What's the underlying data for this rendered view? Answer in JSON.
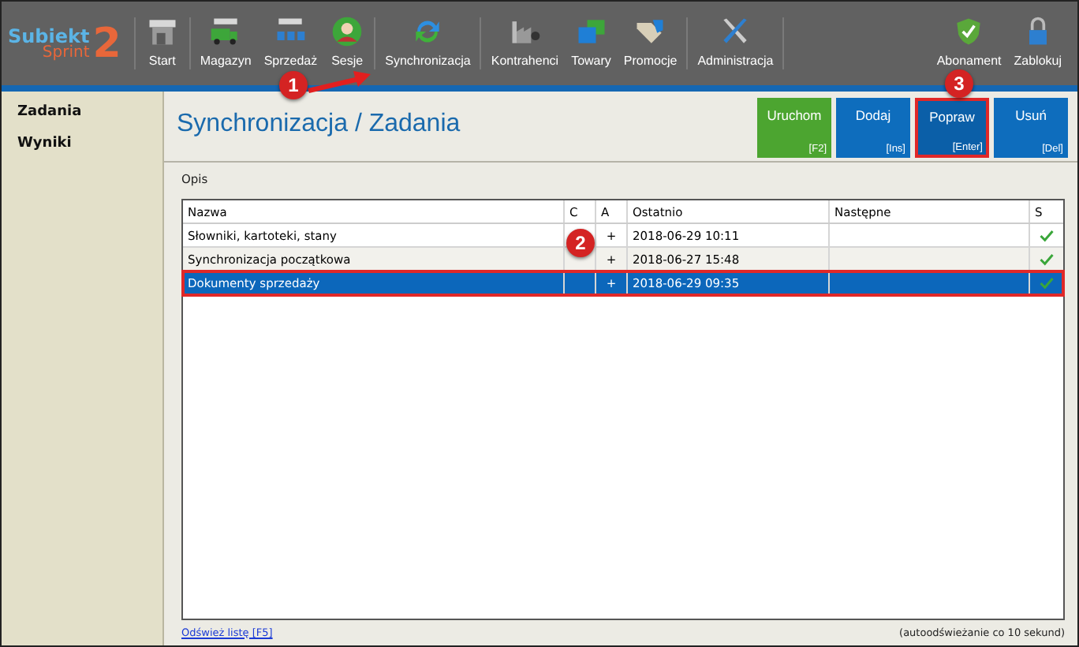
{
  "logo": {
    "name": "Subiekt",
    "sub": "Sprint",
    "num": "2"
  },
  "toolbar": {
    "left": [
      [
        {
          "label": "Start"
        }
      ],
      [
        {
          "label": "Magazyn"
        },
        {
          "label": "Sprzedaż"
        },
        {
          "label": "Sesje"
        }
      ],
      [
        {
          "label": "Synchronizacja"
        }
      ],
      [
        {
          "label": "Kontrahenci"
        },
        {
          "label": "Towary"
        },
        {
          "label": "Promocje"
        }
      ],
      [
        {
          "label": "Administracja"
        }
      ]
    ],
    "right": [
      {
        "label": "Abonament"
      },
      {
        "label": "Zablokuj"
      }
    ]
  },
  "sidebar": {
    "items": [
      {
        "label": "Zadania"
      },
      {
        "label": "Wyniki"
      }
    ]
  },
  "page_title": "Synchronizacja / Zadania",
  "actions": [
    {
      "label": "Uruchom",
      "key": "[F2]",
      "kind": "run",
      "selected": false
    },
    {
      "label": "Dodaj",
      "key": "[Ins]",
      "kind": "normal",
      "selected": false
    },
    {
      "label": "Popraw",
      "key": "[Enter]",
      "kind": "normal",
      "selected": true
    },
    {
      "label": "Usuń",
      "key": "[Del]",
      "kind": "normal",
      "selected": false
    }
  ],
  "description_label": "Opis",
  "table": {
    "columns": [
      "Nazwa",
      "C",
      "A",
      "Ostatnio",
      "Następne",
      "S"
    ],
    "rows": [
      {
        "name": "Słowniki, kartoteki, stany",
        "a": "+",
        "last": "2018-06-29 10:11",
        "ok": true,
        "selected": false
      },
      {
        "name": "Synchronizacja początkowa",
        "a": "+",
        "last": "2018-06-27 15:48",
        "ok": true,
        "selected": false
      },
      {
        "name": "Dokumenty sprzedaży",
        "a": "+",
        "last": "2018-06-29 09:35",
        "ok": true,
        "selected": true
      }
    ]
  },
  "refresh_link": "Odśwież listę [F5]",
  "autorefresh_note": "(autoodświeżanie co 10 sekund)",
  "callouts": [
    {
      "label": "1"
    },
    {
      "label": "2"
    },
    {
      "label": "3"
    }
  ]
}
